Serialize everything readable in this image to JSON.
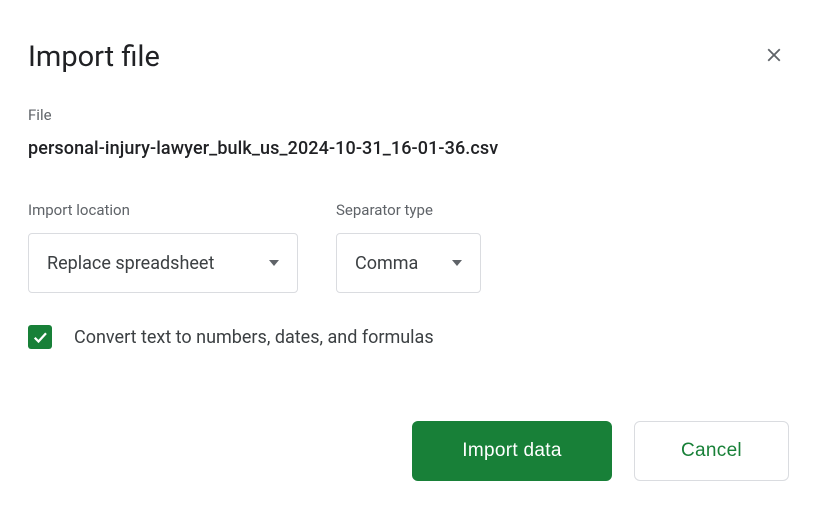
{
  "dialog": {
    "title": "Import file",
    "file_label": "File",
    "filename": "personal-injury-lawyer_bulk_us_2024-10-31_16-01-36.csv",
    "import_location": {
      "label": "Import location",
      "value": "Replace spreadsheet"
    },
    "separator": {
      "label": "Separator type",
      "value": "Comma"
    },
    "convert_checkbox": {
      "checked": true,
      "label": "Convert text to numbers, dates, and formulas"
    },
    "actions": {
      "primary": "Import data",
      "secondary": "Cancel"
    }
  }
}
